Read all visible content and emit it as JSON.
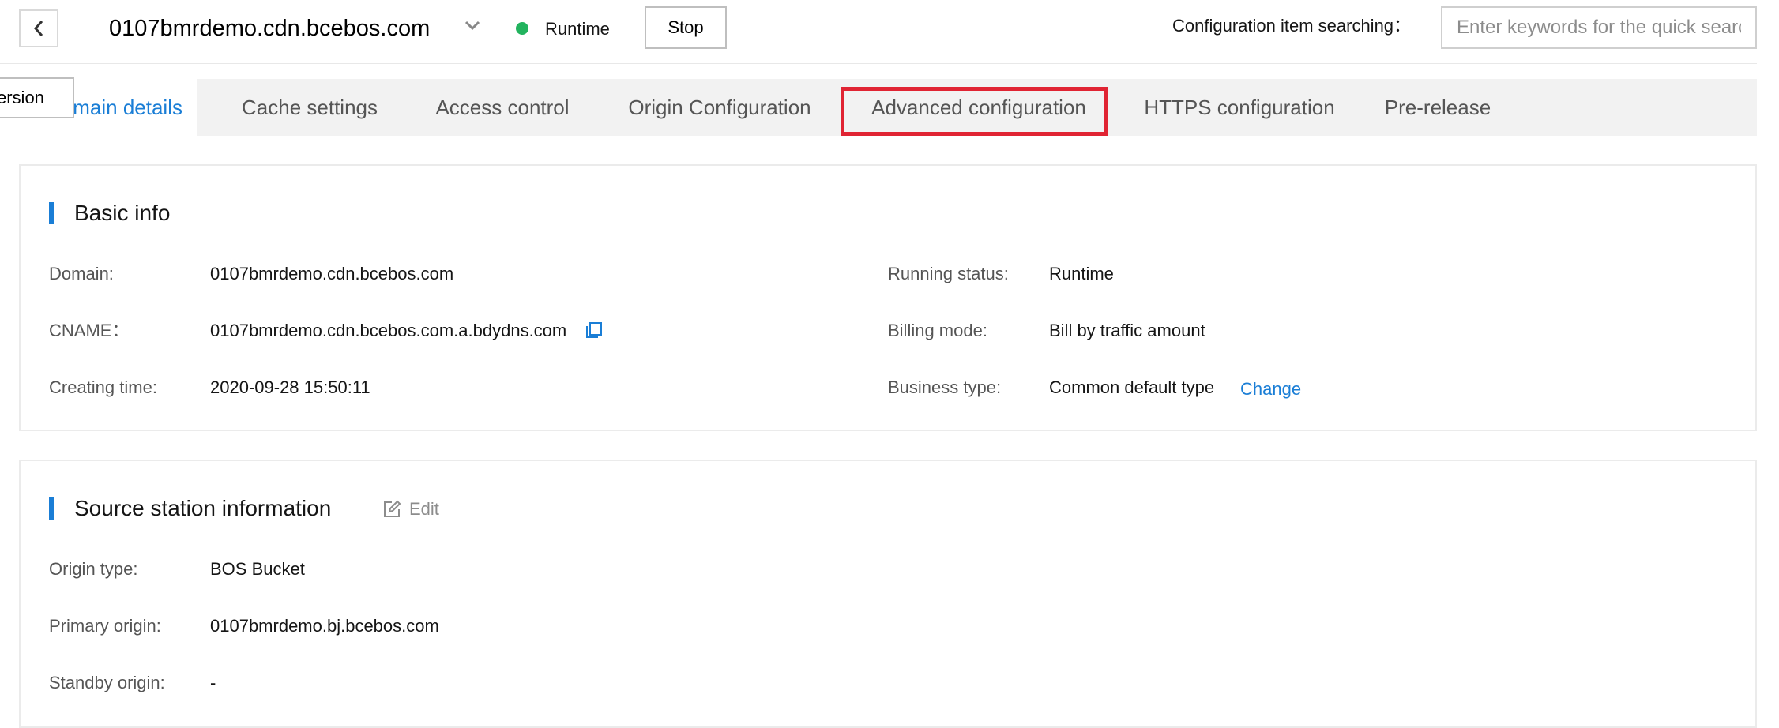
{
  "header": {
    "domain": "0107bmrdemo.cdn.bcebos.com",
    "status": "Runtime",
    "stop_label": "Stop",
    "search_label": "Configuration item searching：",
    "search_placeholder": "Enter keywords for the quick search"
  },
  "version_tag": "ersion",
  "tabs": [
    {
      "label": "Domain details",
      "active": true
    },
    {
      "label": "Cache settings"
    },
    {
      "label": "Access control"
    },
    {
      "label": "Origin Configuration"
    },
    {
      "label": "Advanced configuration",
      "highlighted": true
    },
    {
      "label": "HTTPS configuration"
    },
    {
      "label": "Pre-release"
    }
  ],
  "basic_info": {
    "title": "Basic info",
    "domain_label": "Domain:",
    "domain_value": "0107bmrdemo.cdn.bcebos.com",
    "cname_label": "CNAME：",
    "cname_value": "0107bmrdemo.cdn.bcebos.com.a.bdydns.com",
    "created_label": "Creating time:",
    "created_value": "2020-09-28 15:50:11",
    "running_label": "Running status:",
    "running_value": "Runtime",
    "billing_label": "Billing mode:",
    "billing_value": "Bill by traffic amount",
    "business_label": "Business type:",
    "business_value": "Common default type",
    "change_label": "Change"
  },
  "source_info": {
    "title": "Source station information",
    "edit_label": "Edit",
    "origin_type_label": "Origin type:",
    "origin_type_value": "BOS Bucket",
    "primary_label": "Primary origin:",
    "primary_value": "0107bmrdemo.bj.bcebos.com",
    "standby_label": "Standby origin:",
    "standby_value": "-"
  },
  "colors": {
    "accent": "#1a7ed6",
    "status_green": "#22b35e",
    "highlight_red": "#e02433"
  },
  "icons": [
    "chevron-left-icon",
    "chevron-down-icon",
    "copy-icon",
    "edit-icon"
  ]
}
